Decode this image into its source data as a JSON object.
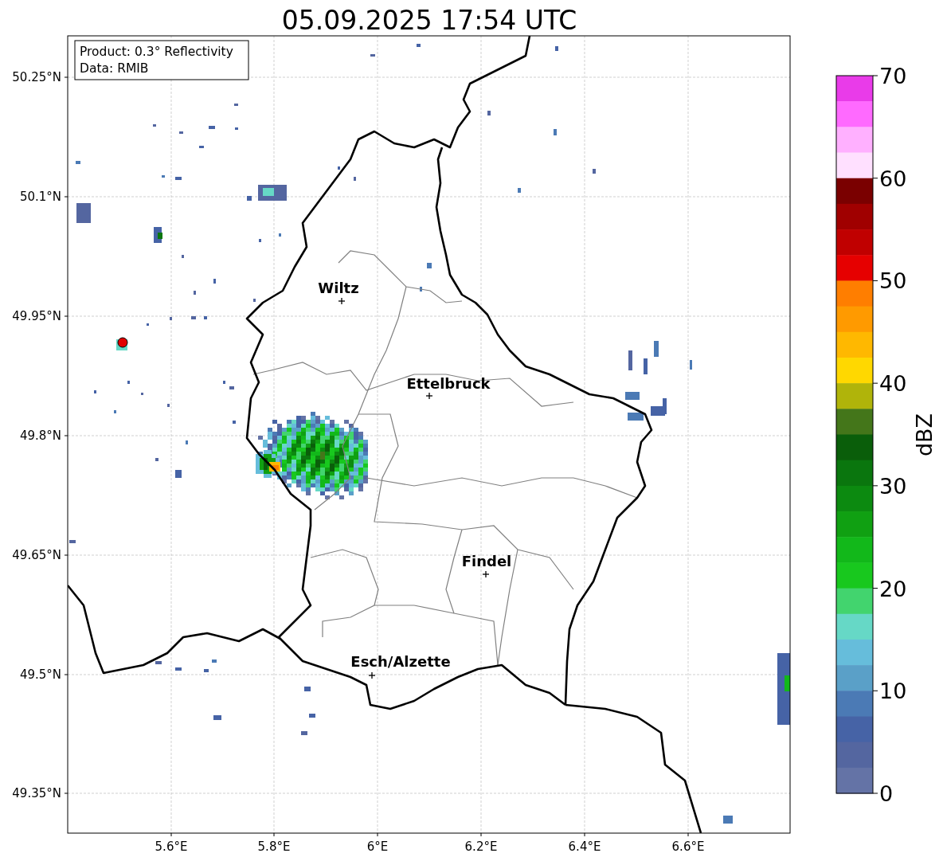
{
  "title": "05.09.2025 17:54 UTC",
  "annotation": [
    "Product: 0.3° Reflectivity",
    "Data: RMIB"
  ],
  "y_ticks": [
    "50.25°N",
    "50.1°N",
    "49.95°N",
    "49.8°N",
    "49.65°N",
    "49.5°N",
    "49.35°N"
  ],
  "x_ticks": [
    "5.6°E",
    "5.8°E",
    "6°E",
    "6.2°E",
    "6.4°E",
    "6.6°E"
  ],
  "cities": [
    {
      "name": "Wiltz"
    },
    {
      "name": "Ettelbruck"
    },
    {
      "name": "Findel"
    },
    {
      "name": "Esch/Alzette"
    }
  ],
  "colorbar": {
    "label": "dBZ",
    "ticks": [
      "70",
      "60",
      "50",
      "40",
      "30",
      "20",
      "10",
      "0"
    ],
    "segments": [
      {
        "color": "#e93be9"
      },
      {
        "color": "#ff6aff"
      },
      {
        "color": "#ffb0ff"
      },
      {
        "color": "#ffe0ff"
      },
      {
        "color": "#7a0000"
      },
      {
        "color": "#a00000"
      },
      {
        "color": "#c00000"
      },
      {
        "color": "#e60000"
      },
      {
        "color": "#ff7e00"
      },
      {
        "color": "#ff9a00"
      },
      {
        "color": "#ffb800"
      },
      {
        "color": "#ffd800"
      },
      {
        "color": "#b0b40a"
      },
      {
        "color": "#44761a"
      },
      {
        "color": "#0a5e0a"
      },
      {
        "color": "#0a760e"
      },
      {
        "color": "#0c8a10"
      },
      {
        "color": "#10a012"
      },
      {
        "color": "#12b81a"
      },
      {
        "color": "#18c81e"
      },
      {
        "color": "#42d46e"
      },
      {
        "color": "#66d8c6"
      },
      {
        "color": "#66bddb"
      },
      {
        "color": "#5aa0c8"
      },
      {
        "color": "#4b7ab5"
      },
      {
        "color": "#4663a6"
      },
      {
        "color": "#5466a0"
      },
      {
        "color": "#6473a6"
      }
    ]
  }
}
